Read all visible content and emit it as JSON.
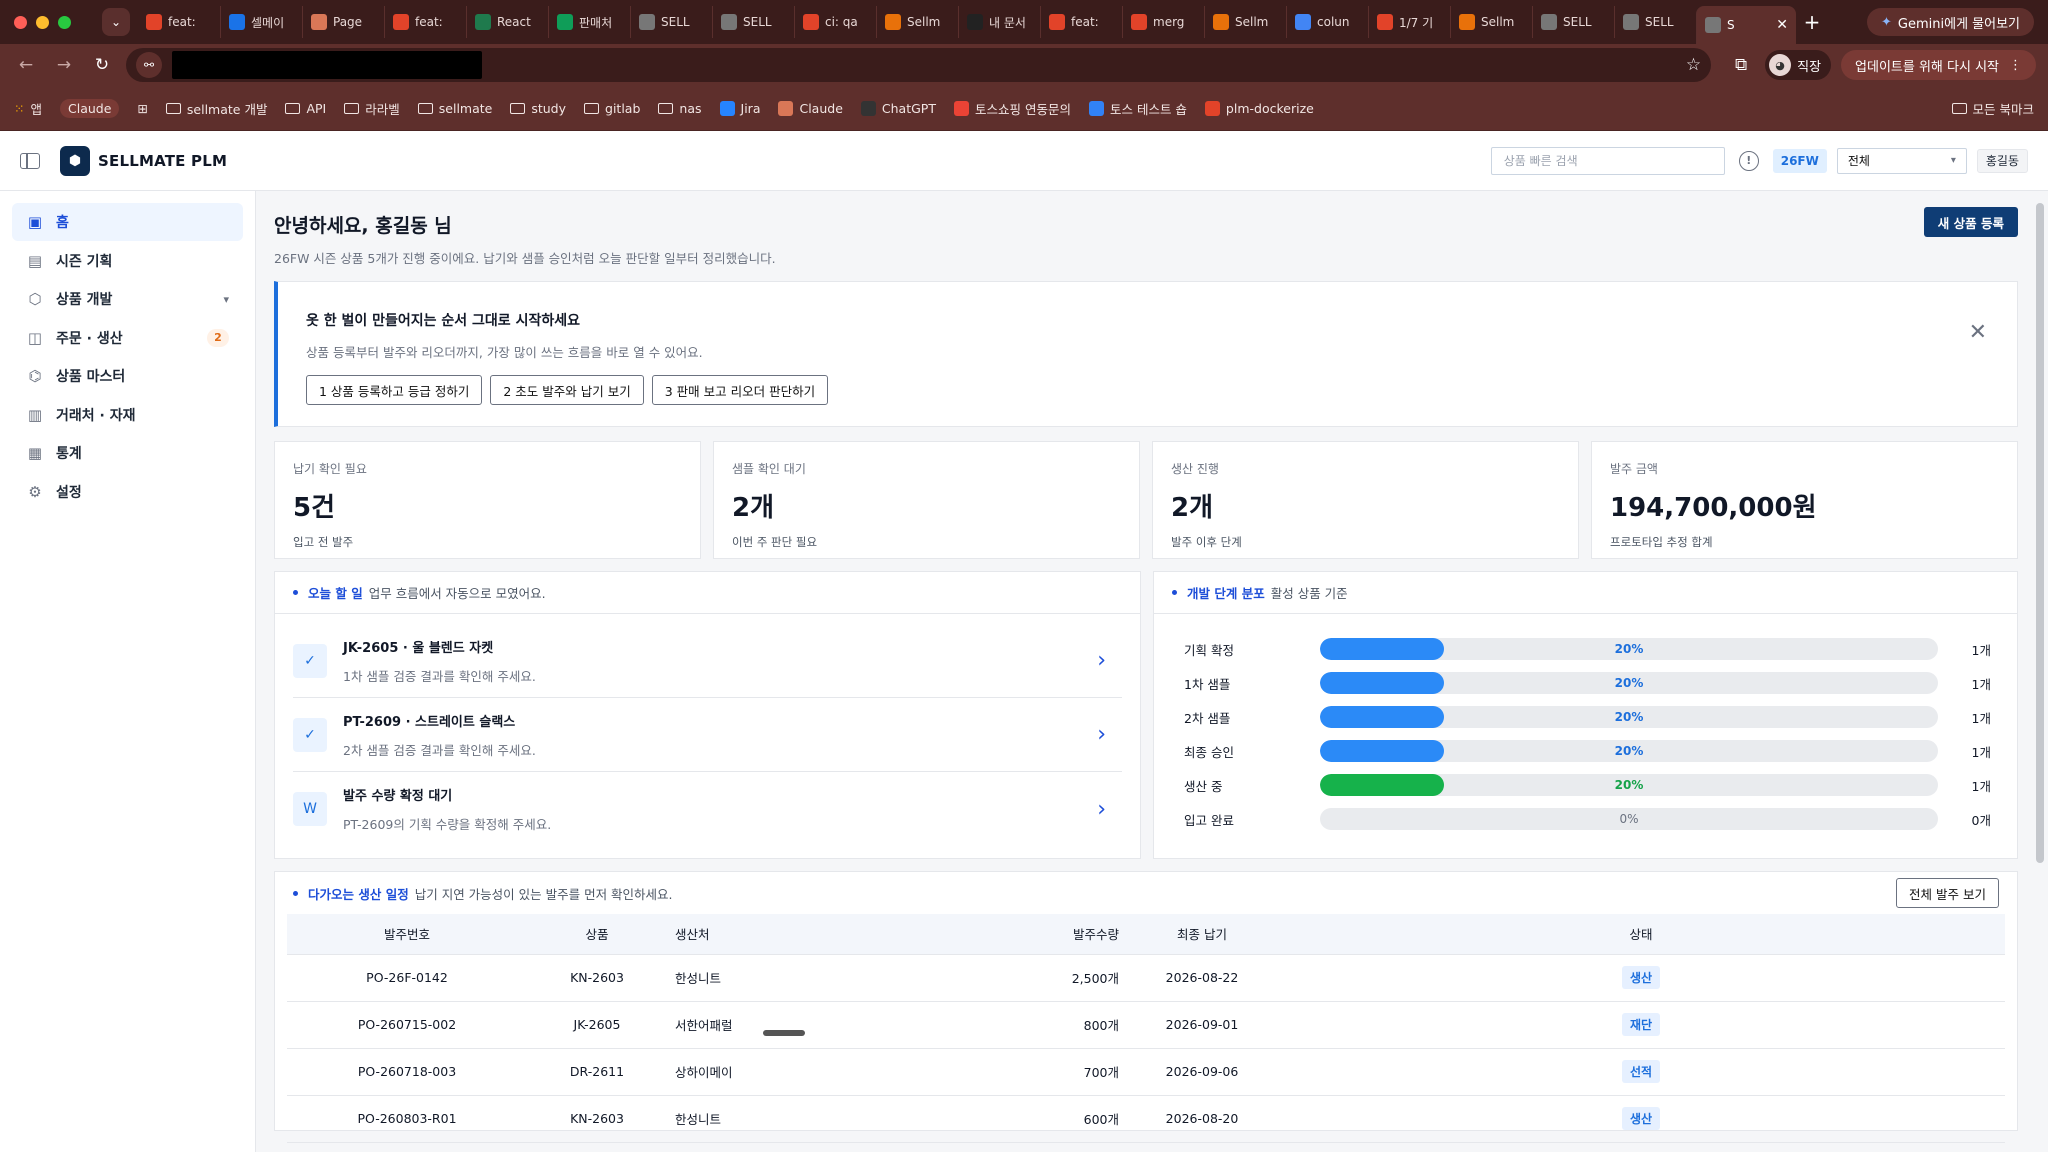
{
  "browser": {
    "tabs": [
      {
        "title": "feat:",
        "color": "#e24329"
      },
      {
        "title": "셀메이",
        "color": "#1a73e8"
      },
      {
        "title": "Page",
        "color": "#d97757"
      },
      {
        "title": "feat:",
        "color": "#e24329"
      },
      {
        "title": "React",
        "color": "#1f7a4d"
      },
      {
        "title": "판매처",
        "color": "#0f9d58"
      },
      {
        "title": "SELL",
        "color": "#777777"
      },
      {
        "title": "SELL",
        "color": "#777777"
      },
      {
        "title": "ci: qa",
        "color": "#e24329"
      },
      {
        "title": "Sellm",
        "color": "#e8710a"
      },
      {
        "title": "내 문서",
        "color": "#222222"
      },
      {
        "title": "feat:",
        "color": "#e24329"
      },
      {
        "title": "merg",
        "color": "#e24329"
      },
      {
        "title": "Sellm",
        "color": "#e8710a"
      },
      {
        "title": "colun",
        "color": "#4285f4"
      },
      {
        "title": "1/7 기",
        "color": "#e24329"
      },
      {
        "title": "Sellm",
        "color": "#e8710a"
      },
      {
        "title": "SELL",
        "color": "#777777"
      },
      {
        "title": "SELL",
        "color": "#777777"
      }
    ],
    "active_tab": {
      "title": "S"
    },
    "gemini_label": "Gemini에게 물어보기",
    "profile_label": "직장",
    "update_label": "업데이트를 위해 다시 시작",
    "bookmarks": [
      {
        "label": "앱",
        "kind": "apps"
      },
      {
        "label": "Claude",
        "kind": "pill"
      },
      {
        "label": "",
        "kind": "grid"
      },
      {
        "label": "sellmate 개발",
        "kind": "folder"
      },
      {
        "label": "API",
        "kind": "folder"
      },
      {
        "label": "라라벨",
        "kind": "folder"
      },
      {
        "label": "sellmate",
        "kind": "folder"
      },
      {
        "label": "study",
        "kind": "folder"
      },
      {
        "label": "gitlab",
        "kind": "folder"
      },
      {
        "label": "nas",
        "kind": "folder"
      },
      {
        "label": "Jira",
        "kind": "fav",
        "color": "#2684ff"
      },
      {
        "label": "Claude",
        "kind": "fav",
        "color": "#d97757"
      },
      {
        "label": "ChatGPT",
        "kind": "fav",
        "color": "#333333"
      },
      {
        "label": "토스쇼핑 연동문의",
        "kind": "fav",
        "color": "#ea4335"
      },
      {
        "label": "토스 테스트 숍",
        "kind": "fav",
        "color": "#3182f6"
      },
      {
        "label": "plm-dockerize",
        "kind": "fav",
        "color": "#e24329"
      }
    ],
    "all_bookmarks": "모든 북마크"
  },
  "header": {
    "brand": "SELLMATE PLM",
    "search_placeholder": "상품 빠른 검색",
    "season": "26FW",
    "scope": "전체",
    "user": "홍길동"
  },
  "sidebar": {
    "items": [
      {
        "label": "홈",
        "icon": "dashboard-icon",
        "glyph": "▣",
        "active": true
      },
      {
        "label": "시즌 기획",
        "icon": "calendar-icon",
        "glyph": "▤"
      },
      {
        "label": "상품 개발",
        "icon": "cube-icon",
        "glyph": "⬡",
        "chevron": true
      },
      {
        "label": "주문 · 생산",
        "icon": "order-icon",
        "glyph": "◫",
        "badge": "2"
      },
      {
        "label": "상품 마스터",
        "icon": "hierarchy-icon",
        "glyph": "⌬"
      },
      {
        "label": "거래처 · 자재",
        "icon": "building-icon",
        "glyph": "▥"
      },
      {
        "label": "통계",
        "icon": "report-icon",
        "glyph": "▦"
      },
      {
        "label": "설정",
        "icon": "gear-icon",
        "glyph": "⚙"
      }
    ]
  },
  "main": {
    "greeting": "안녕하세요, 홍길동 님",
    "subtitle": "26FW 시즌 상품 5개가 진행 중이에요. 납기와 샘플 승인처럼 오늘 판단할 일부터 정리했습니다.",
    "new_product": "새 상품 등록",
    "onboarding": {
      "title": "옷 한 벌이 만들어지는 순서 그대로 시작하세요",
      "desc": "상품 등록부터 발주와 리오더까지, 가장 많이 쓰는 흐름을 바로 열 수 있어요.",
      "steps": [
        "1 상품 등록하고 등급 정하기",
        "2 초도 발주와 납기 보기",
        "3 판매 보고 리오더 판단하기"
      ]
    },
    "kpis": [
      {
        "label": "납기 확인 필요",
        "value": "5건",
        "note": "입고 전 발주"
      },
      {
        "label": "샘플 확인 대기",
        "value": "2개",
        "note": "이번 주 판단 필요"
      },
      {
        "label": "생산 진행",
        "value": "2개",
        "note": "발주 이후 단계"
      },
      {
        "label": "발주 금액",
        "value": "194,700,000원",
        "note": "프로토타입 추정 합계"
      }
    ],
    "todo": {
      "title": "오늘 할 일",
      "hint": "업무 흐름에서 자동으로 모였어요.",
      "items": [
        {
          "title": "JK-2605 · 울 블렌드 자켓",
          "desc": "1차 샘플 검증 결과를 확인해 주세요.",
          "icon": "check-circle-icon",
          "glyph": "✓"
        },
        {
          "title": "PT-2609 · 스트레이트 슬랙스",
          "desc": "2차 샘플 검증 결과를 확인해 주세요.",
          "icon": "check-circle-icon",
          "glyph": "✓"
        },
        {
          "title": "발주 수량 확정 대기",
          "desc": "PT-2609의 기획 수량을 확정해 주세요.",
          "icon": "order-icon",
          "glyph": "W"
        }
      ]
    },
    "distribution": {
      "title": "개발 단계 분포",
      "hint": "활성 상품 기준",
      "rows": [
        {
          "label": "기획 확정",
          "pct": 20,
          "pct_label": "20%",
          "count": "1개",
          "color": "#2b8af7"
        },
        {
          "label": "1차 샘플",
          "pct": 20,
          "pct_label": "20%",
          "count": "1개",
          "color": "#2b8af7"
        },
        {
          "label": "2차 샘플",
          "pct": 20,
          "pct_label": "20%",
          "count": "1개",
          "color": "#2b8af7"
        },
        {
          "label": "최종 승인",
          "pct": 20,
          "pct_label": "20%",
          "count": "1개",
          "color": "#2b8af7"
        },
        {
          "label": "생산 중",
          "pct": 20,
          "pct_label": "20%",
          "count": "1개",
          "color": "#16b24b"
        },
        {
          "label": "입고 완료",
          "pct": 0,
          "pct_label": "0%",
          "count": "0개",
          "color": "#2b8af7"
        }
      ]
    },
    "schedule": {
      "title": "다가오는 생산 일정",
      "hint": "납기 지연 가능성이 있는 발주를 먼저 확인하세요.",
      "view_all": "전체 발주 보기",
      "columns": [
        "발주번호",
        "상품",
        "생산처",
        "발주수량",
        "최종 납기",
        "상태"
      ],
      "rows": [
        [
          "PO-26F-0142",
          "KN-2603",
          "한성니트",
          "2,500개",
          "2026-08-22",
          "생산"
        ],
        [
          "PO-260715-002",
          "JK-2605",
          "서한어패럴",
          "800개",
          "2026-09-01",
          "재단"
        ],
        [
          "PO-260718-003",
          "DR-2611",
          "상하이메이",
          "700개",
          "2026-09-06",
          "선적"
        ],
        [
          "PO-260803-R01",
          "KN-2603",
          "한성니트",
          "600개",
          "2026-08-20",
          "생산"
        ]
      ]
    }
  }
}
